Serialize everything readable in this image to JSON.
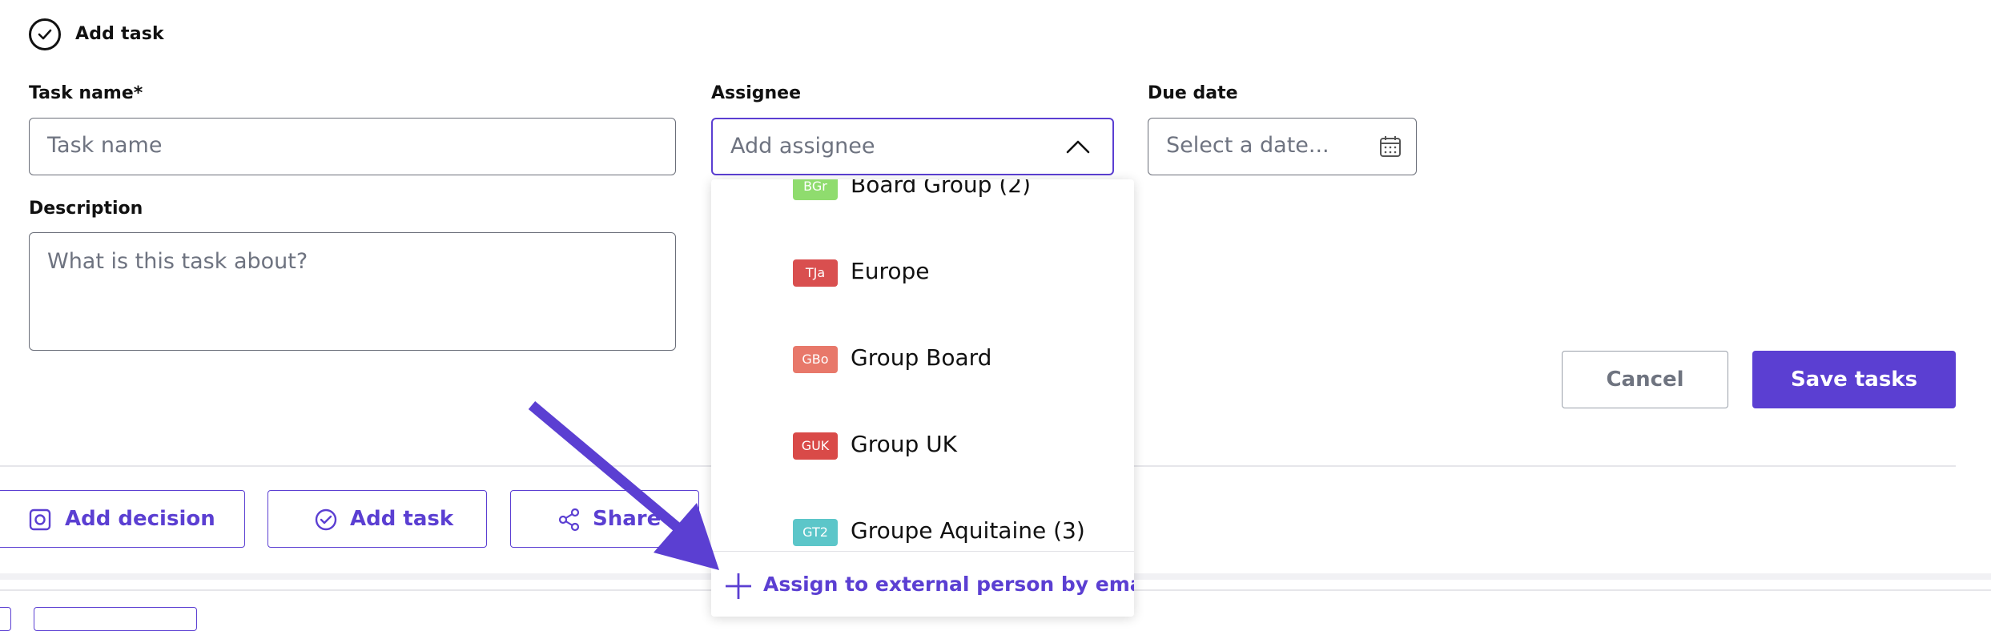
{
  "header": {
    "title": "Add task",
    "icon": "check-circle-icon"
  },
  "form": {
    "task_name": {
      "label": "Task name*",
      "placeholder": "Task name"
    },
    "assignee": {
      "label": "Assignee",
      "placeholder": "Add assignee"
    },
    "due_date": {
      "label": "Due date",
      "placeholder": "Select a date..."
    },
    "description": {
      "label": "Description",
      "placeholder": "What is this task about?"
    }
  },
  "assignee_dropdown": {
    "options": [
      {
        "badge": "BGr",
        "label": "Board Group (2)",
        "color": "#8fdc6e"
      },
      {
        "badge": "TJa",
        "label": "Europe",
        "color": "#d94f4f"
      },
      {
        "badge": "GBo",
        "label": "Group Board",
        "color": "#e8786a"
      },
      {
        "badge": "GUK",
        "label": "Group UK",
        "color": "#d94a48"
      },
      {
        "badge": "GT2",
        "label": "Groupe Aquitaine (3)",
        "color": "#5cc6c9"
      }
    ],
    "external_action": "Assign to external person by email"
  },
  "buttons": {
    "cancel": "Cancel",
    "save": "Save tasks"
  },
  "actions": {
    "add_decision": "Add decision",
    "add_task": "Add task",
    "share": "Share"
  },
  "colors": {
    "accent": "#5b3fd2",
    "annotation_arrow": "#5b3fd2"
  }
}
